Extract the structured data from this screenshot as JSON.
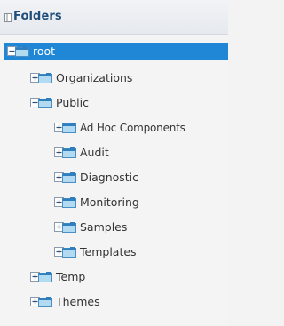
{
  "panel": {
    "title": "Folders",
    "icon": "panel-icon"
  },
  "colors": {
    "header_title": "#1f4e7a",
    "selected_bg": "#1f87d6",
    "folder_body": "#b2dbf1",
    "folder_tab": "#2f7fbf"
  },
  "tree": {
    "root": {
      "label": "root",
      "expanded": true,
      "selected": true
    },
    "organizations": {
      "label": "Organizations",
      "expanded": false
    },
    "public": {
      "label": "Public",
      "expanded": true
    },
    "ad_hoc_components": {
      "label": "Ad Hoc Components",
      "expanded": false
    },
    "audit": {
      "label": "Audit",
      "expanded": false
    },
    "diagnostic": {
      "label": "Diagnostic",
      "expanded": false
    },
    "monitoring": {
      "label": "Monitoring",
      "expanded": false
    },
    "samples": {
      "label": "Samples",
      "expanded": false
    },
    "templates": {
      "label": "Templates",
      "expanded": false
    },
    "temp": {
      "label": "Temp",
      "expanded": false
    },
    "themes": {
      "label": "Themes",
      "expanded": false
    }
  }
}
